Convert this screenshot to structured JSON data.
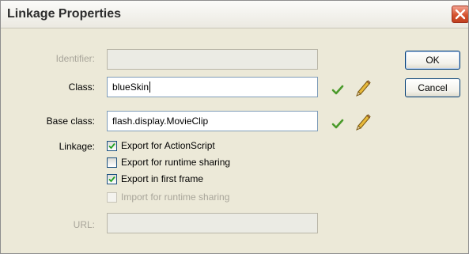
{
  "window": {
    "title": "Linkage Properties"
  },
  "form": {
    "identifier": {
      "label": "Identifier:",
      "value": ""
    },
    "class": {
      "label": "Class:",
      "value": "blueSkin"
    },
    "base_class": {
      "label": "Base class:",
      "value": "flash.display.MovieClip"
    },
    "linkage": {
      "label": "Linkage:"
    },
    "url": {
      "label": "URL:",
      "value": ""
    }
  },
  "options": [
    {
      "label": "Export for ActionScript",
      "checked": true,
      "enabled": true
    },
    {
      "label": "Export for runtime sharing",
      "checked": false,
      "enabled": true
    },
    {
      "label": "Export in first frame",
      "checked": true,
      "enabled": true
    },
    {
      "label": "Import for runtime sharing",
      "checked": false,
      "enabled": false
    }
  ],
  "buttons": {
    "ok": "OK",
    "cancel": "Cancel"
  },
  "icons": {
    "validate": "check-icon",
    "edit": "pencil-icon",
    "close": "close-icon"
  },
  "colors": {
    "check": "#4a9a2a",
    "close_button": "#d5532f",
    "accent_border": "#7f9db9"
  }
}
